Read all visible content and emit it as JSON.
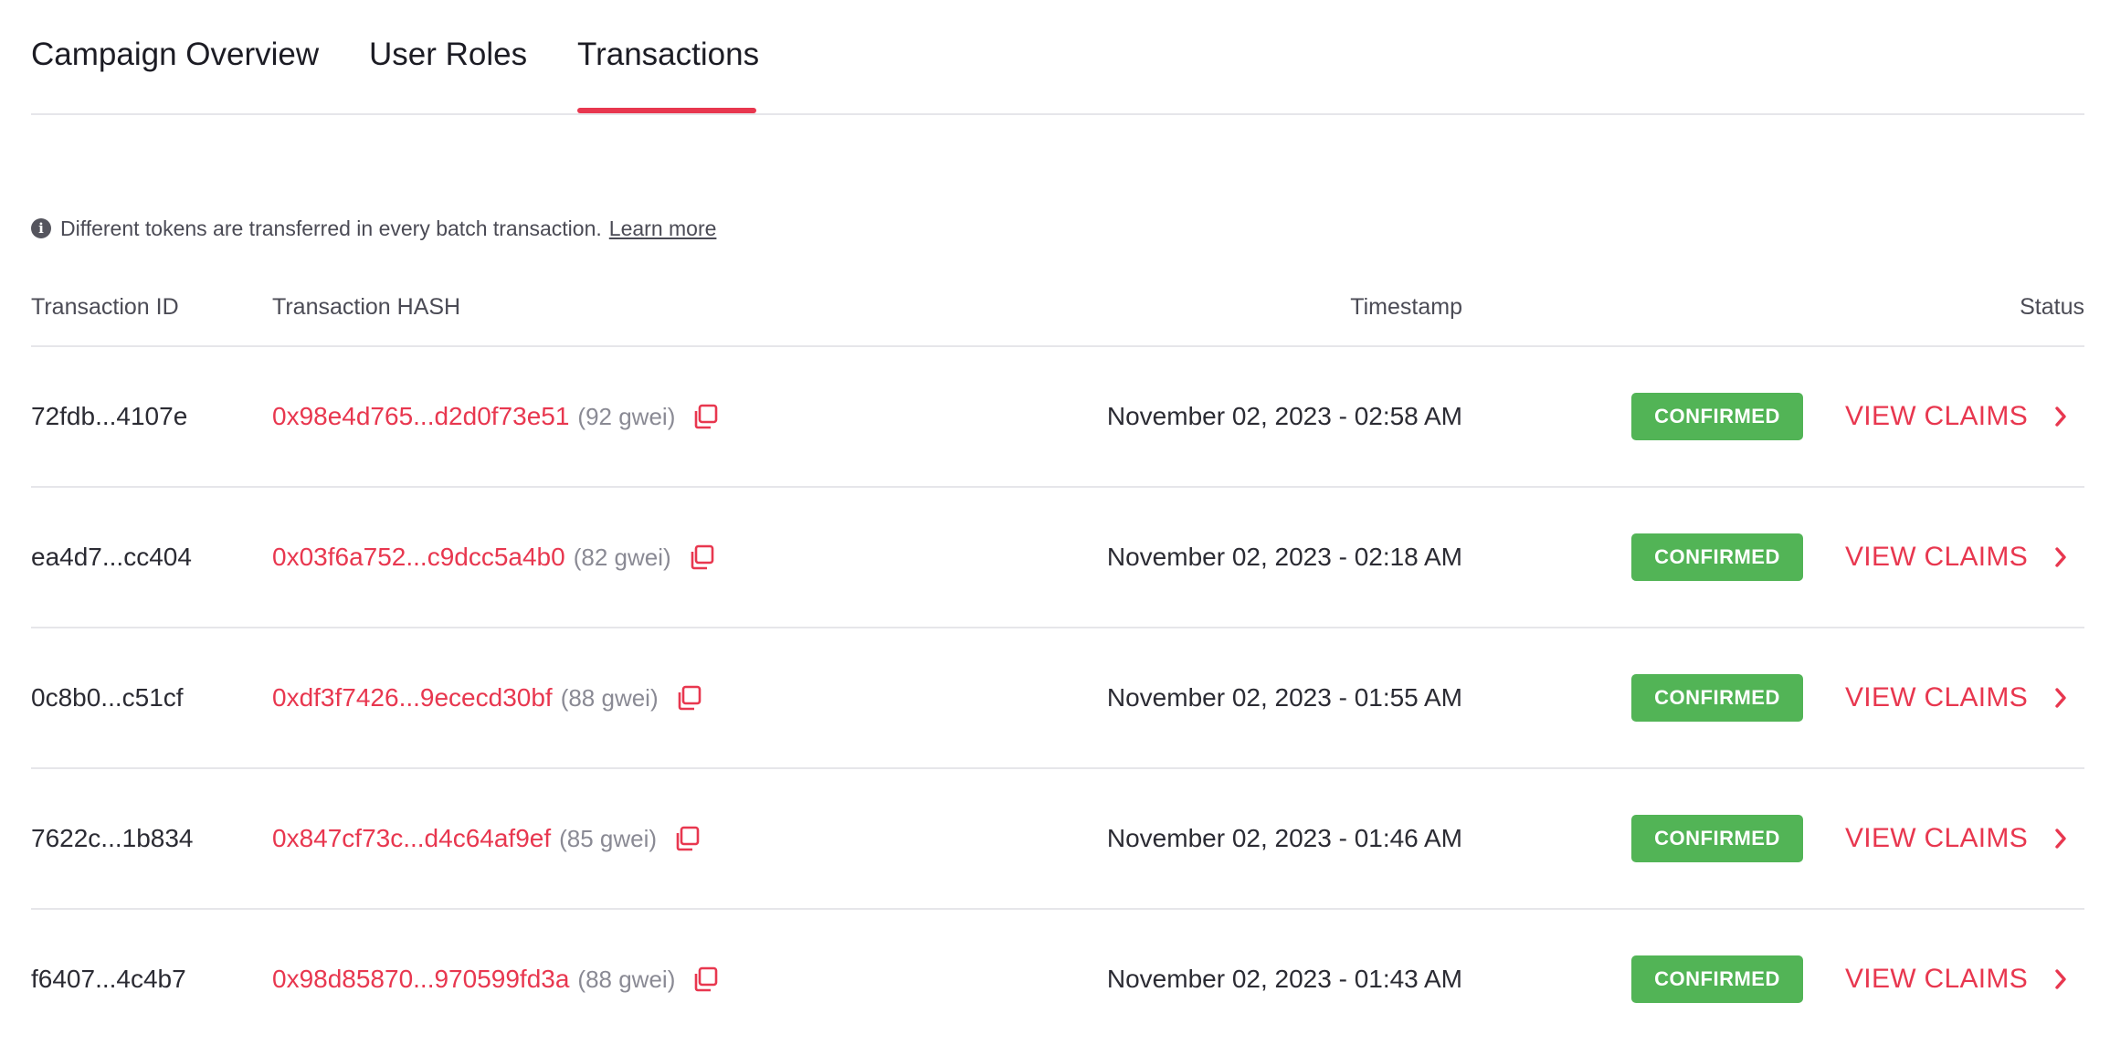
{
  "tabs": [
    {
      "label": "Campaign Overview",
      "active": false
    },
    {
      "label": "User Roles",
      "active": false
    },
    {
      "label": "Transactions",
      "active": true
    }
  ],
  "info": {
    "icon": "info-icon",
    "text": "Different tokens are transferred in every batch transaction.",
    "link": "Learn more"
  },
  "table": {
    "headers": {
      "id": "Transaction ID",
      "hash": "Transaction HASH",
      "timestamp": "Timestamp",
      "status": "Status"
    },
    "rows": [
      {
        "id": "72fdb...4107e",
        "hash": "0x98e4d765...d2d0f73e51",
        "gwei": "(92 gwei)",
        "timestamp": "November 02, 2023 - 02:58 AM",
        "status": "CONFIRMED",
        "action": "VIEW CLAIMS"
      },
      {
        "id": "ea4d7...cc404",
        "hash": "0x03f6a752...c9dcc5a4b0",
        "gwei": "(82 gwei)",
        "timestamp": "November 02, 2023 - 02:18 AM",
        "status": "CONFIRMED",
        "action": "VIEW CLAIMS"
      },
      {
        "id": "0c8b0...c51cf",
        "hash": "0xdf3f7426...9ececd30bf",
        "gwei": "(88 gwei)",
        "timestamp": "November 02, 2023 - 01:55 AM",
        "status": "CONFIRMED",
        "action": "VIEW CLAIMS"
      },
      {
        "id": "7622c...1b834",
        "hash": "0x847cf73c...d4c64af9ef",
        "gwei": "(85 gwei)",
        "timestamp": "November 02, 2023 - 01:46 AM",
        "status": "CONFIRMED",
        "action": "VIEW CLAIMS"
      },
      {
        "id": "f6407...4c4b7",
        "hash": "0x98d85870...970599fd3a",
        "gwei": "(88 gwei)",
        "timestamp": "November 02, 2023 - 01:43 AM",
        "status": "CONFIRMED",
        "action": "VIEW CLAIMS"
      }
    ]
  },
  "colors": {
    "accent": "#e8374f",
    "confirmed": "#52b456",
    "divider": "#e6e6ea"
  }
}
